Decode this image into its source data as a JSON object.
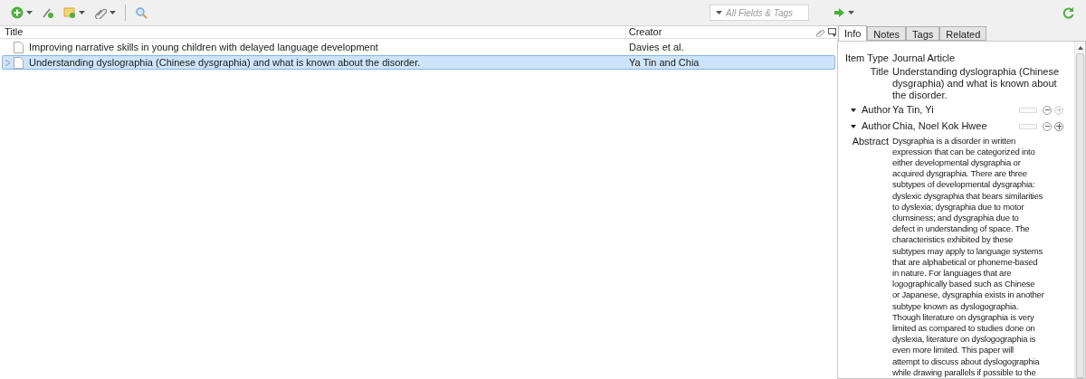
{
  "search": {
    "placeholder": "All Fields & Tags"
  },
  "table": {
    "columns": [
      "Title",
      "Creator"
    ],
    "rows": [
      {
        "title": "Improving narrative skills in young children with delayed language development",
        "creator": "Davies et al.",
        "selected": false,
        "expandable": false
      },
      {
        "title": "Understanding dyslographia (Chinese dysgraphia) and what is known about the disorder.",
        "creator": "Ya Tin and Chia",
        "selected": true,
        "expandable": true
      }
    ]
  },
  "tabs": [
    {
      "label": "Info",
      "selected": true
    },
    {
      "label": "Notes",
      "selected": false
    },
    {
      "label": "Tags",
      "selected": false
    },
    {
      "label": "Related",
      "selected": false
    }
  ],
  "info": {
    "item_type": {
      "label": "Item Type",
      "value": "Journal Article"
    },
    "title": {
      "label": "Title",
      "value": "Understanding dyslographia (Chinese dysgraphia) and what is known about the disorder."
    },
    "authors": [
      {
        "label": "Author",
        "value": "Ya Tin, Yi",
        "plus_disabled": true
      },
      {
        "label": "Author",
        "value": "Chia, Noel Kok Hwee",
        "plus_disabled": false
      }
    ],
    "abstract": {
      "label": "Abstract",
      "lines": [
        "Dysgraphia is a disorder in written",
        "expression that can be categorized into",
        "either developmental dysgraphia or",
        "acquired dysgraphia. There are three",
        "subtypes of developmental dysgraphia:",
        "dyslexic dysgraphia that bears similarities",
        "to dyslexia; dysgraphia due to motor",
        "clumsiness; and dysgraphia due to",
        "defect in understanding of space. The",
        "characteristics exhibited by these",
        "subtypes may apply to language systems",
        "that are alphabetical or phoneme-based",
        "in nature. For languages that are",
        "logographically based such as Chinese",
        "or Japanese, dysgraphia exists in another",
        "subtype known as dyslogographia.",
        "Though literature on dysgraphia is very",
        "limited as compared to studies done on",
        "dyslexia, literature on dyslogographia is",
        "even more limited. This paper will",
        "attempt to discuss about dyslogographia",
        "while drawing parallels if possible to the"
      ]
    }
  }
}
